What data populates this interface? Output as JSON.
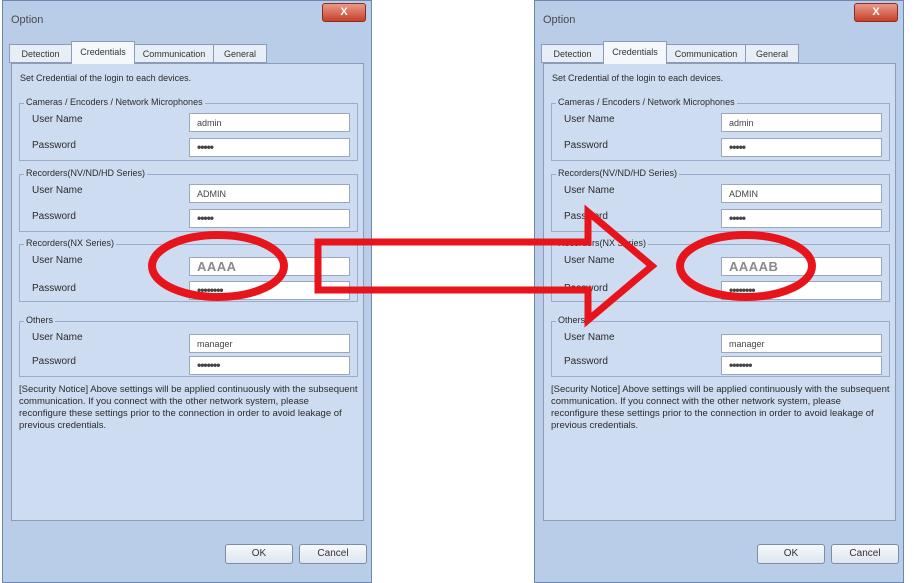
{
  "dialogs": [
    {
      "title": "Option",
      "close_label": "X",
      "tabs": [
        "Detection",
        "Credentials",
        "Communication",
        "General"
      ],
      "intro": "Set Credential of the login to each devices.",
      "groups": [
        {
          "title": "Cameras / Encoders / Network Microphones",
          "user_label": "User Name",
          "user_value": "admin",
          "pw_label": "Password",
          "pw_value": "•••••"
        },
        {
          "title": "Recorders(NV/ND/HD Series)",
          "user_label": "User Name",
          "user_value": "ADMIN",
          "pw_label": "Password",
          "pw_value": "•••••"
        },
        {
          "title": "Recorders(NX Series)",
          "user_label": "User Name",
          "user_value": "AAAA",
          "pw_label": "Password",
          "pw_value": "••••••••"
        },
        {
          "title": "Others",
          "user_label": "User Name",
          "user_value": "manager",
          "pw_label": "Password",
          "pw_value": "•••••••"
        }
      ],
      "notice": "[Security Notice] Above settings will be applied continuously with the subsequent communication. If you  connect with the other network system, please reconfigure these settings prior to the connection in order to avoid leakage of previous credentials.",
      "ok_label": "OK",
      "cancel_label": "Cancel"
    },
    {
      "title": "Option",
      "close_label": "X",
      "tabs": [
        "Detection",
        "Credentials",
        "Communication",
        "General"
      ],
      "intro": "Set Credential of the login to each devices.",
      "groups": [
        {
          "title": "Cameras / Encoders / Network Microphones",
          "user_label": "User Name",
          "user_value": "admin",
          "pw_label": "Password",
          "pw_value": "•••••"
        },
        {
          "title": "Recorders(NV/ND/HD Series)",
          "user_label": "User Name",
          "user_value": "ADMIN",
          "pw_label": "Password",
          "pw_value": "•••••"
        },
        {
          "title": "Recorders(NX Series)",
          "user_label": "User Name",
          "user_value": "AAAAB",
          "pw_label": "Password",
          "pw_value": "••••••••"
        },
        {
          "title": "Others",
          "user_label": "User Name",
          "user_value": "manager",
          "pw_label": "Password",
          "pw_value": "•••••••"
        }
      ],
      "notice": "[Security Notice] Above settings will be applied continuously with the subsequent communication. If you  connect with the other network system, please reconfigure these settings prior to the connection in order to avoid leakage of previous credentials.",
      "ok_label": "OK",
      "cancel_label": "Cancel"
    }
  ],
  "annotation": {
    "color": "#e8141b",
    "arrow": "right-arrow",
    "highlight": "ellipse-outline"
  }
}
